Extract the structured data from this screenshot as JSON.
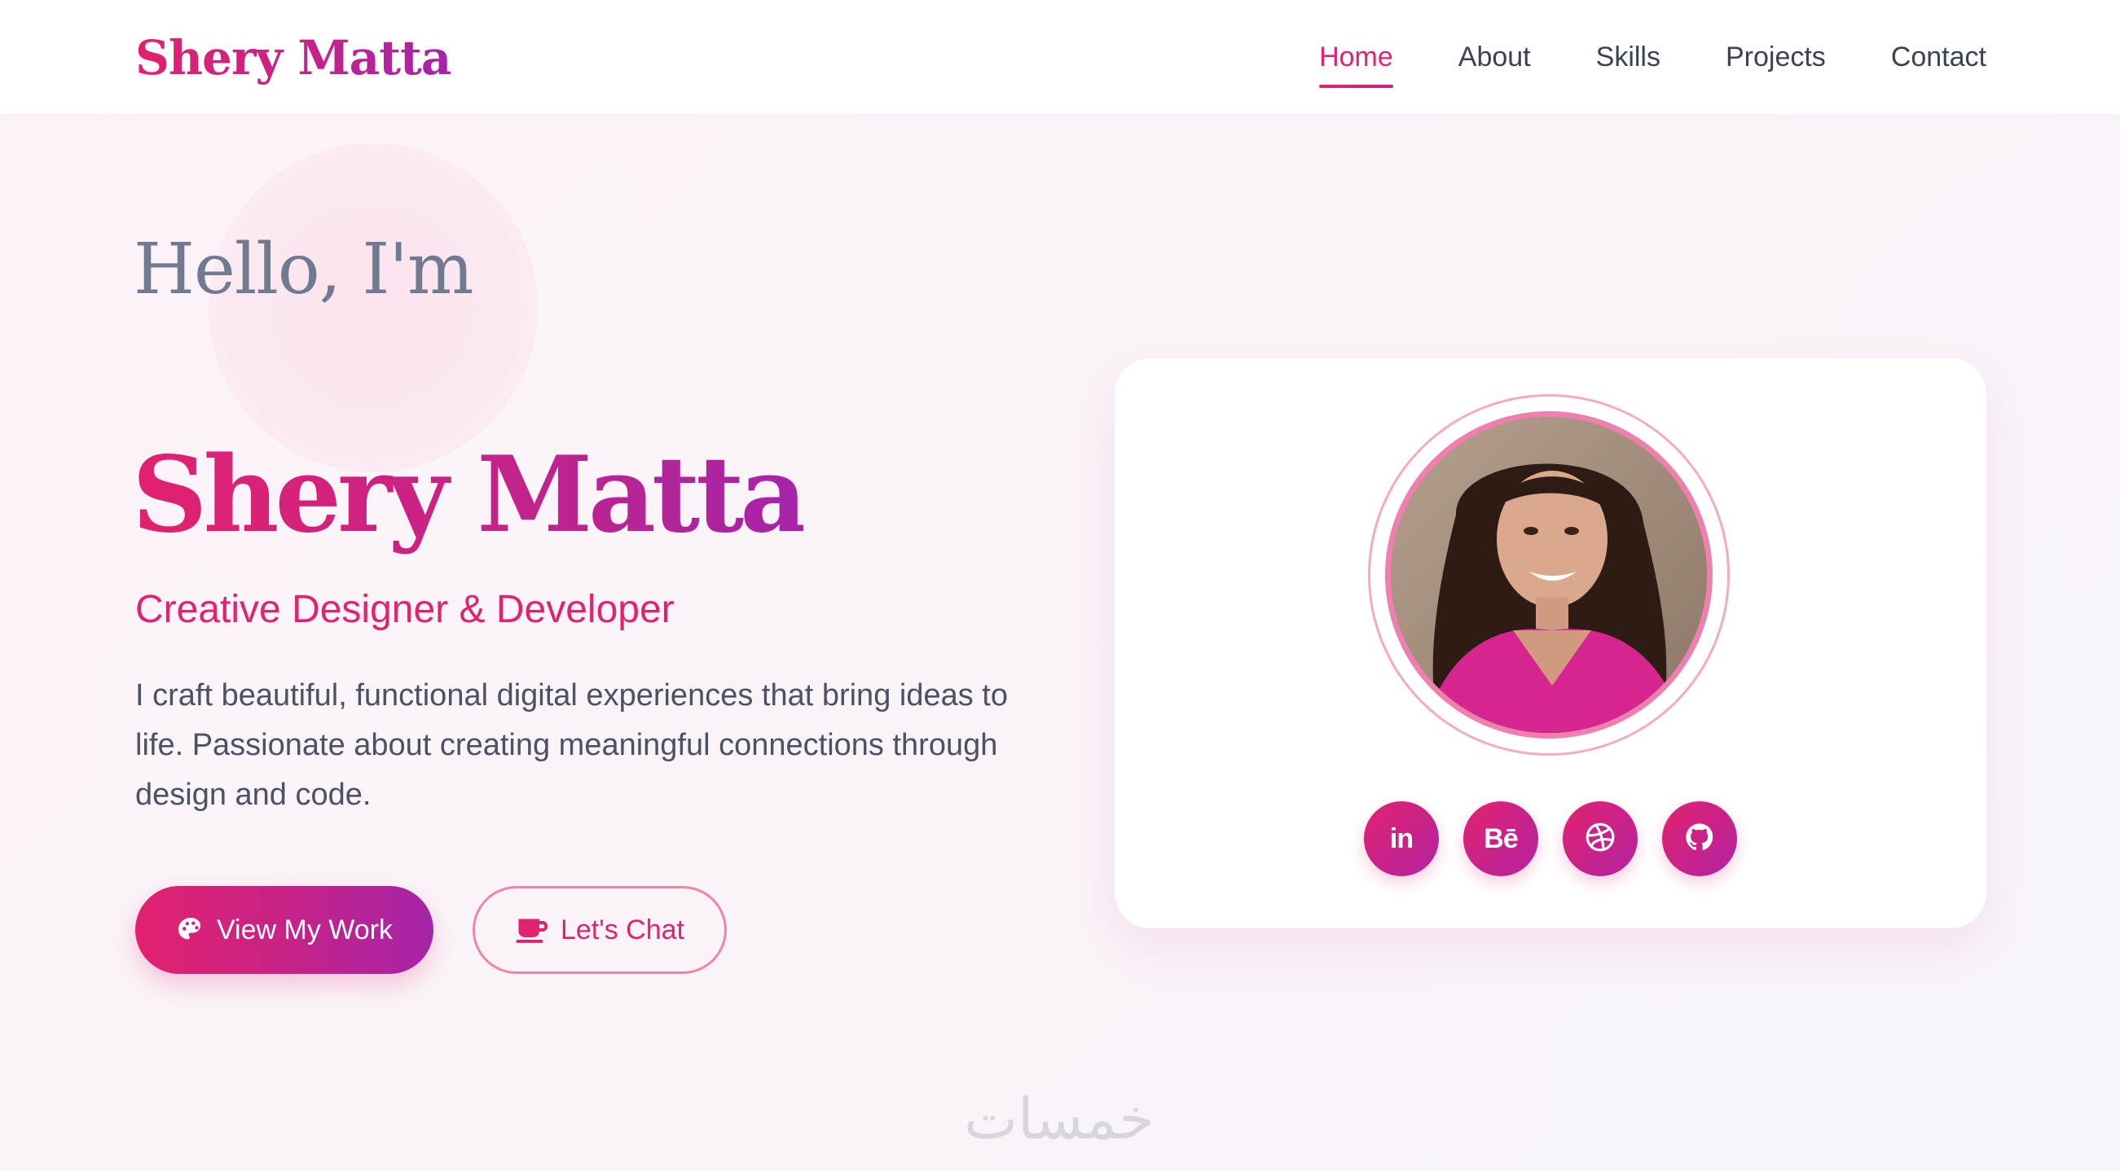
{
  "header": {
    "logo": "Shery Matta",
    "nav": [
      {
        "label": "Home",
        "active": true
      },
      {
        "label": "About",
        "active": false
      },
      {
        "label": "Skills",
        "active": false
      },
      {
        "label": "Projects",
        "active": false
      },
      {
        "label": "Contact",
        "active": false
      }
    ]
  },
  "hero": {
    "greeting": "Hello, I'm",
    "name": "Shery Matta",
    "subtitle": "Creative Designer & Developer",
    "intro": "I craft beautiful, functional digital experiences that bring ideas to life. Passionate about creating meaningful connections through design and code.",
    "buttons": {
      "primary": {
        "label": "View My Work",
        "icon": "palette-icon"
      },
      "secondary": {
        "label": "Let's Chat",
        "icon": "coffee-icon"
      }
    }
  },
  "profile_card": {
    "photo": "profile-photo",
    "socials": [
      {
        "name": "linkedin",
        "text": "in",
        "icon": "linkedin-icon"
      },
      {
        "name": "behance",
        "text": "Bē",
        "icon": "behance-icon"
      },
      {
        "name": "dribbble",
        "icon": "dribbble-icon"
      },
      {
        "name": "github",
        "icon": "github-icon"
      }
    ]
  },
  "watermark": "خمسات",
  "colors": {
    "accent": "#e2216f",
    "accent_end": "#a524a8",
    "text_dark": "#3b4254",
    "text_muted": "#707a90",
    "ring": "#f4a9c6"
  }
}
